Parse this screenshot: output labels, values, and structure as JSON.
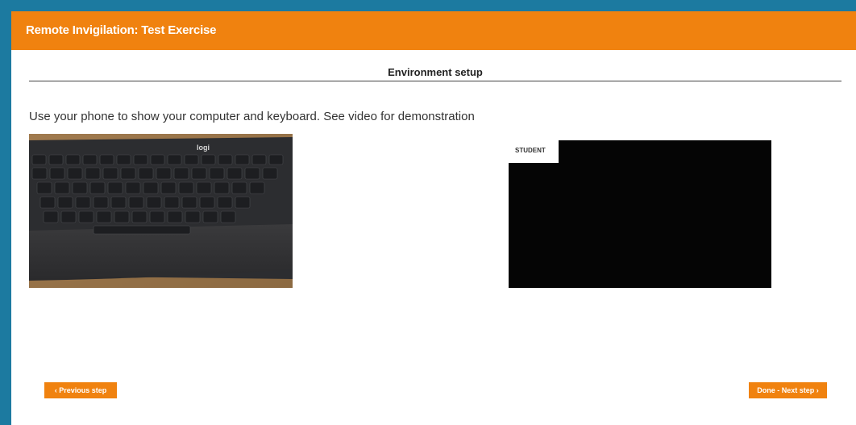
{
  "window": {
    "title": "Remote Invigilation: Test Exercise"
  },
  "section": {
    "title": "Environment setup"
  },
  "instruction": "Use your phone to show your computer and keyboard. See video for demonstration",
  "photo": {
    "description_icon": "keyboard-photo",
    "brand": "logi"
  },
  "video": {
    "label": "STUDENT"
  },
  "nav": {
    "prev_chevron": "‹",
    "prev_label": "Previous step",
    "next_label": "Done - Next step",
    "next_chevron": "›"
  },
  "colors": {
    "accent": "#f0820f",
    "frame": "#1c7aa0",
    "video_bg": "#050505"
  }
}
